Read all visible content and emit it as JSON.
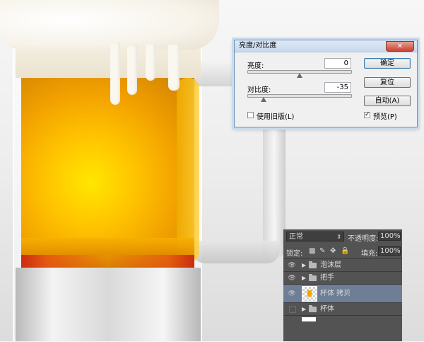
{
  "dialog": {
    "title": "亮度/对比度",
    "close_symbol": "✕",
    "brightness_label": "亮度:",
    "brightness_value": "0",
    "contrast_label": "对比度:",
    "contrast_value": "-35",
    "ok_label": "确定",
    "reset_label": "复位",
    "auto_label": "自动(A)",
    "use_legacy_label": "使用旧版(L)",
    "use_legacy_checked": false,
    "preview_label": "预览(P)",
    "preview_checked": true,
    "preview_check_glyph": "✓"
  },
  "layers": {
    "blend_mode": "正常",
    "opacity_label": "不透明度:",
    "opacity_value": "100%",
    "lock_label": "锁定:",
    "fill_label": "填充:",
    "fill_value": "100%",
    "lock_icons": [
      "▩",
      "✎",
      "✥",
      "🔒"
    ],
    "items": [
      {
        "name": "泡沫层",
        "type": "group",
        "visible": true
      },
      {
        "name": "把手",
        "type": "group",
        "visible": true
      },
      {
        "name": "杯体 拷贝",
        "type": "layer",
        "visible": true,
        "selected": true
      },
      {
        "name": "杯体",
        "type": "group",
        "visible": false
      }
    ]
  },
  "colors": {
    "selected_row": "#6e7e95",
    "panel_bg": "#535353",
    "beer_amber": "#ffc400"
  }
}
